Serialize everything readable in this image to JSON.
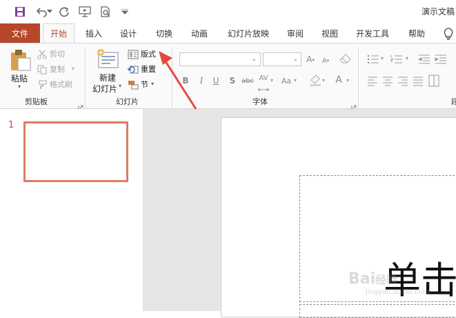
{
  "window": {
    "title": "演示文稿"
  },
  "tabs": [
    {
      "label": "文件"
    },
    {
      "label": "开始"
    },
    {
      "label": "插入"
    },
    {
      "label": "设计"
    },
    {
      "label": "切换"
    },
    {
      "label": "动画"
    },
    {
      "label": "幻灯片放映"
    },
    {
      "label": "审阅"
    },
    {
      "label": "视图"
    },
    {
      "label": "开发工具"
    },
    {
      "label": "帮助"
    }
  ],
  "clipboard": {
    "paste": "粘贴",
    "cut": "剪切",
    "copy": "复制",
    "format_painter": "格式刷",
    "group": "剪贴板"
  },
  "slides_group": {
    "new_slide_line1": "新建",
    "new_slide_line2": "幻灯片",
    "layout": "版式",
    "reset": "重置",
    "section": "节",
    "group": "幻灯片"
  },
  "font_group": {
    "group": "字体",
    "bold": "B",
    "italic": "I",
    "underline": "U",
    "shadow": "S",
    "strike": "abc",
    "spacing": "AV",
    "change_case": "Aa",
    "font_color": "A"
  },
  "paragraph_group": {
    "group_partial": "段"
  },
  "thumbnails": {
    "slide_number": "1"
  },
  "slide": {
    "title_placeholder_text": "单击"
  },
  "watermark": {
    "main": "Bai",
    "brand": "经验",
    "sub": "jingyan.baidu.com"
  },
  "colors": {
    "accent": "#b7472a",
    "thumb_border": "#e07a5f",
    "arrow": "#e8483b"
  }
}
